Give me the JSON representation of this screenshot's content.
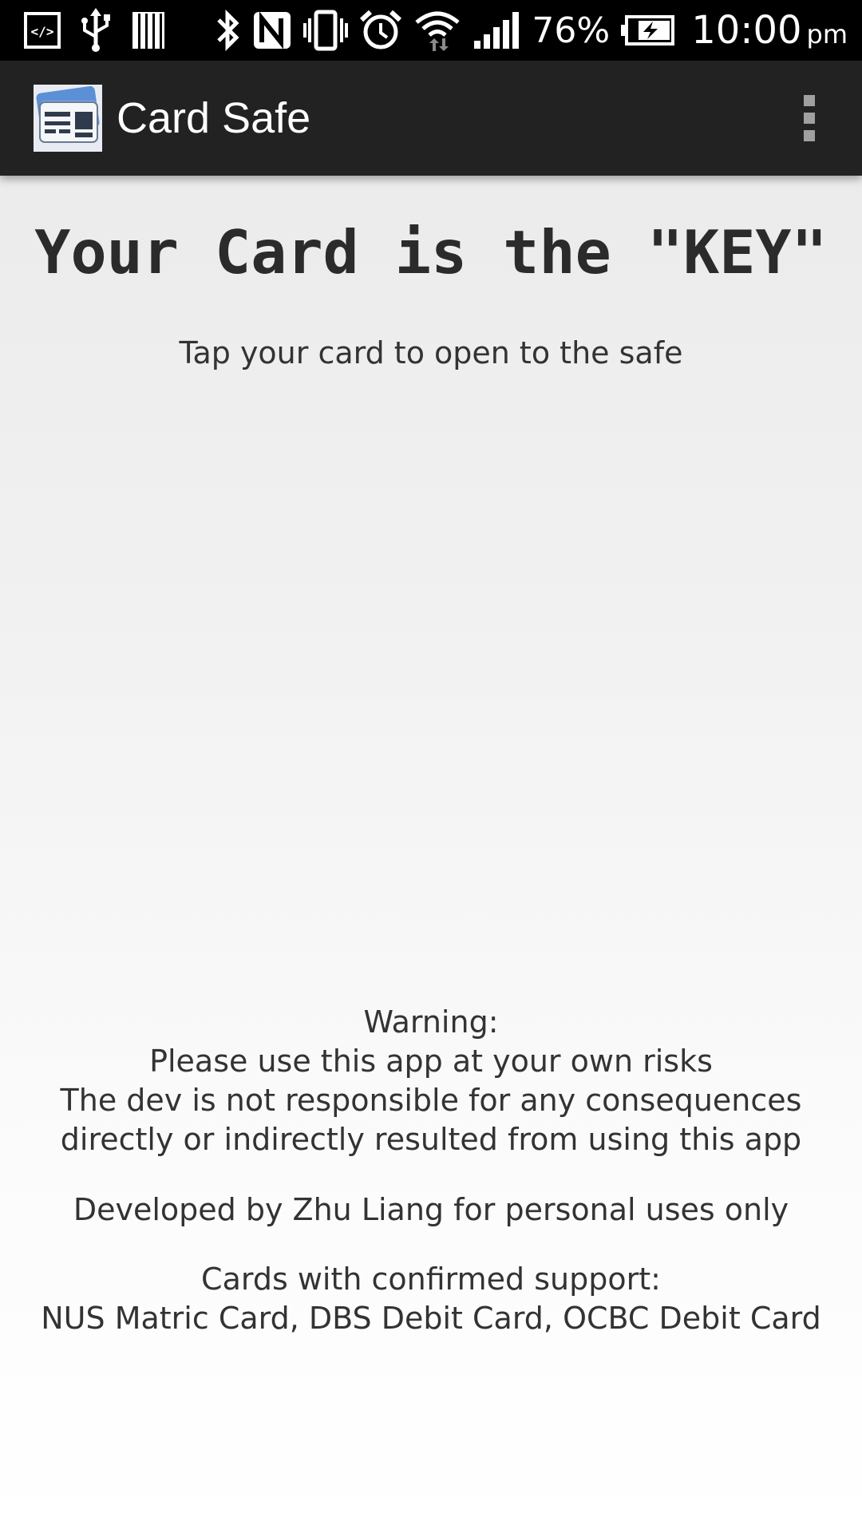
{
  "status_bar": {
    "icons_left": [
      "developer-mode-icon",
      "usb-icon",
      "sd-card-icon"
    ],
    "icons_right": [
      "bluetooth-icon",
      "nfc-icon",
      "vibrate-icon",
      "alarm-icon",
      "wifi-icon",
      "signal-icon",
      "battery-charging-icon"
    ],
    "battery_percent": "76%",
    "time": "10:00",
    "ampm": "pm"
  },
  "action_bar": {
    "app_icon": "card-safe-app-icon",
    "title": "Card Safe",
    "overflow_icon": "overflow-menu-icon"
  },
  "main": {
    "headline": "Your Card is the \"KEY\"",
    "instruction": "Tap your card to open to the safe",
    "warning_lines": [
      "Warning:",
      "Please use this app at your own risks",
      "The dev is not responsible for any consequences",
      "directly or indirectly resulted from using this app"
    ],
    "developer_note": "Developed by Zhu Liang for personal uses only",
    "supported_cards_lines": [
      "Cards with confirmed support:",
      "NUS Matric Card, DBS Debit Card, OCBC Debit Card"
    ]
  },
  "colors": {
    "status_bar_bg": "#000000",
    "action_bar_bg": "#222222",
    "text": "#333333",
    "overflow_dots": "#a0a0a0"
  }
}
